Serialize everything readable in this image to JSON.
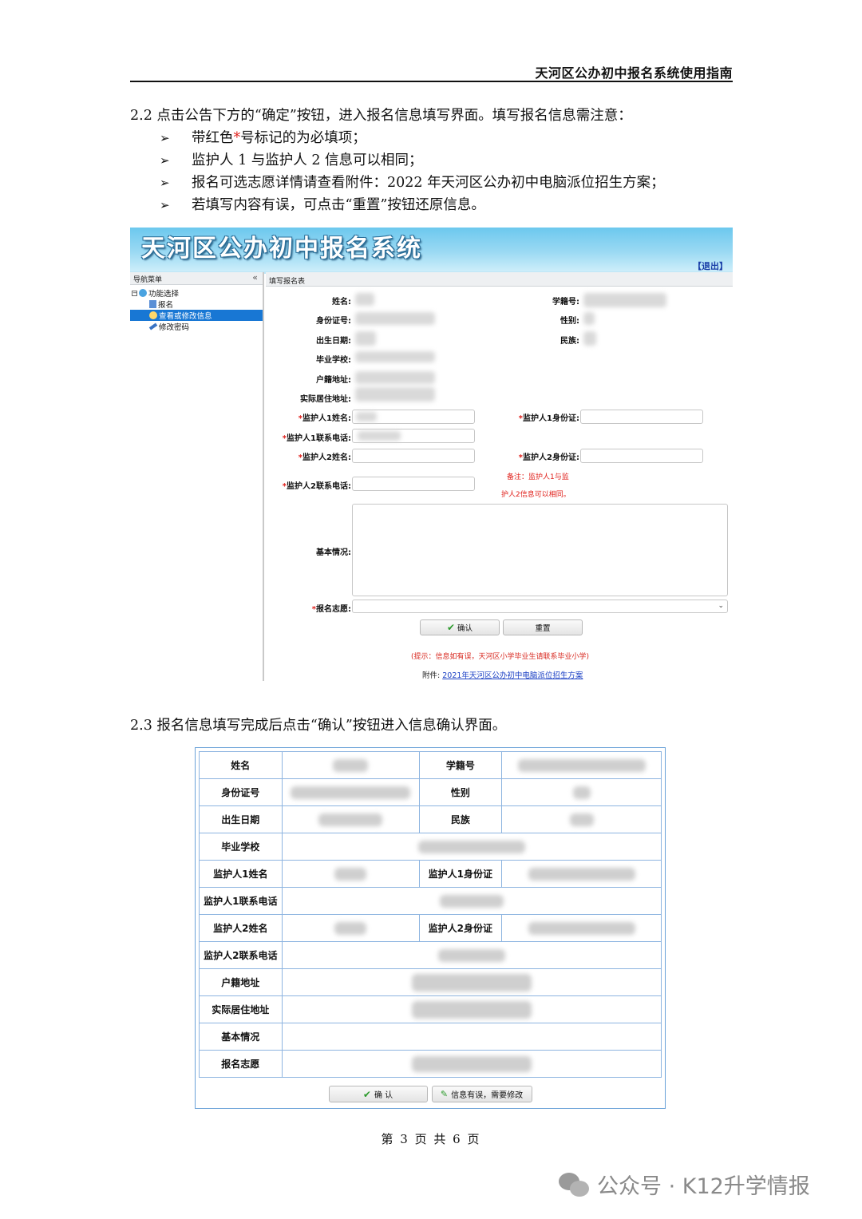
{
  "header": {
    "title": "天河区公办初中报名系统使用指南"
  },
  "section22": {
    "intro": "2.2 点击公告下方的“确定”按钮，进入报名信息填写界面。填写报名信息需注意：",
    "bullet1_pre": "带红色",
    "bullet1_star": "*",
    "bullet1_post": "号标记的为必填项；",
    "bullet2": "监护人 1 与监护人 2 信息可以相同；",
    "bullet3": "报名可选志愿详情请查看附件：2022 年天河区公办初中电脑派位招生方案；",
    "bullet4": "若填写内容有误，可点击“重置”按钮还原信息。"
  },
  "shot1": {
    "banner_title": "天河区公办初中报名系统",
    "logout": "【退出】",
    "nav_title": "导航菜单",
    "collapse": "«",
    "tree": {
      "root": "功能选择",
      "item1": "报名",
      "item2": "查看或修改信息",
      "item3": "修改密码"
    },
    "panel_title": "填写报名表",
    "labels": {
      "name": "姓名:",
      "student_id": "学籍号:",
      "id_card": "身份证号:",
      "gender": "性别:",
      "birth": "出生日期:",
      "ethnicity": "民族:",
      "school": "毕业学校:",
      "hukou": "户籍地址:",
      "residence": "实际居住地址:",
      "g1_name": "监护人1姓名:",
      "g1_id": "监护人1身份证:",
      "g1_phone": "监护人1联系电话:",
      "g2_name": "监护人2姓名:",
      "g2_id": "监护人2身份证:",
      "g2_phone": "监护人2联系电话:",
      "basic": "基本情况:",
      "choice": "报名志愿:"
    },
    "star": "*",
    "note_line1": "备注：监护人1与监",
    "note_line2": "护人2信息可以相同。",
    "btn_confirm": "确认",
    "btn_reset": "重置",
    "hint": "(提示：信息如有误，天河区小学毕业生请联系毕业小学)",
    "attach_label": "附件:",
    "attach_link": "2021年天河区公办初中电脑派位招生方案"
  },
  "section23": {
    "intro": "2.3 报名信息填写完成后点击“确认”按钮进入信息确认界面。"
  },
  "shot2": {
    "rows": [
      {
        "l1": "姓名",
        "l2": "学籍号"
      },
      {
        "l1": "身份证号",
        "l2": "性别"
      },
      {
        "l1": "出生日期",
        "l2": "民族"
      },
      {
        "l1": "毕业学校"
      },
      {
        "l1": "监护人1姓名",
        "l2": "监护人1身份证"
      },
      {
        "l1": "监护人1联系电话"
      },
      {
        "l1": "监护人2姓名",
        "l2": "监护人2身份证"
      },
      {
        "l1": "监护人2联系电话"
      },
      {
        "l1": "户籍地址"
      },
      {
        "l1": "实际居住地址"
      },
      {
        "l1": "基本情况"
      },
      {
        "l1": "报名志愿"
      }
    ],
    "btn_confirm": "确 认",
    "btn_modify": "信息有误，需要修改"
  },
  "footer": {
    "page": "第 3 页 共 6 页"
  },
  "watermark": {
    "text": "公众号 · K12升学情报"
  }
}
